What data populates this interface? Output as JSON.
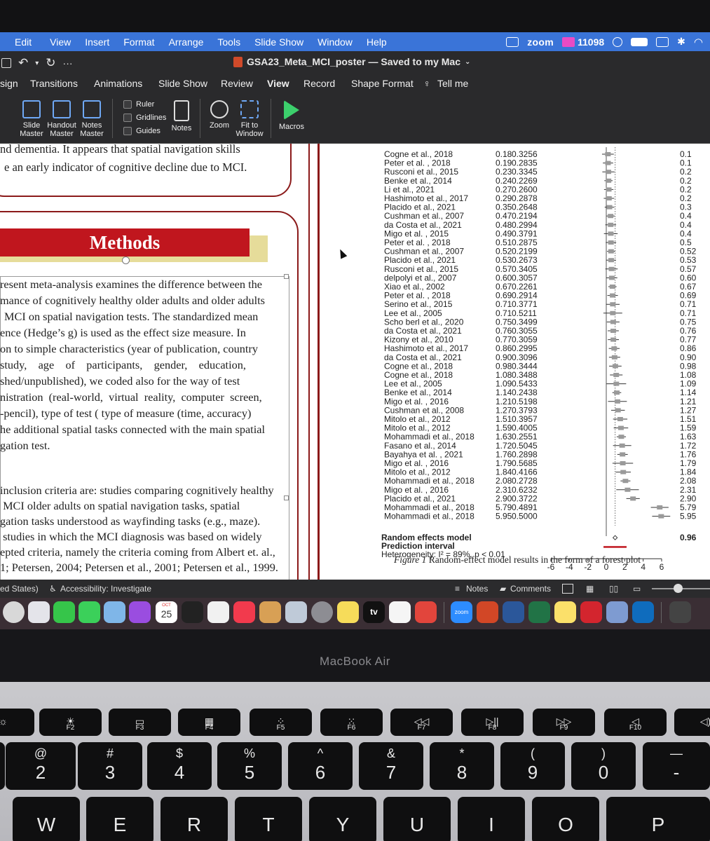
{
  "menubar": {
    "items": [
      "Edit",
      "View",
      "Insert",
      "Format",
      "Arrange",
      "Tools",
      "Slide Show",
      "Window",
      "Help"
    ],
    "zoom": "zoom",
    "mail_count": "11098"
  },
  "titlebar": {
    "document_title": "GSA23_Meta_MCI_poster — Saved to my Mac",
    "qa_more": "···"
  },
  "ribbon": {
    "tabs": [
      "sign",
      "Transitions",
      "Animations",
      "Slide Show",
      "Review",
      "View",
      "Record",
      "Shape Format",
      "Tell me"
    ],
    "active_tab": "View",
    "buttons": {
      "slide_master": [
        "Slide",
        "Master"
      ],
      "handout_master": [
        "Handout",
        "Master"
      ],
      "notes_master": [
        "Notes",
        "Master"
      ],
      "notes": "Notes",
      "zoom": "Zoom",
      "fit_to_window": [
        "Fit to",
        "Window"
      ],
      "macros": "Macros"
    },
    "checkboxes": [
      "Ruler",
      "Gridlines",
      "Guides"
    ]
  },
  "slide": {
    "intro_lines": [
      "nd dementia. It appears that spatial navigation skills",
      "e an early indicator of cognitive decline due to MCI."
    ],
    "methods_heading": "Methods",
    "methods_para1": [
      "resent meta-analysis examines the difference between the",
      "mance of cognitively healthy older adults and older adults",
      "MCI on spatial navigation tests. The standardized mean",
      "ence (Hedge’s g) is used as the effect size measure. In",
      "on to simple characteristics (year of publication, country",
      "study,    age    of    participants,    gender,    education,",
      "shed/unpublished), we coded also for the way of test",
      "nistration  (real-world,  virtual  reality,  computer  screen,",
      "-pencil), type of test ( type of measure (time, accuracy)",
      "he additional spatial tasks connected with the main spatial",
      "gation test."
    ],
    "methods_para2": [
      "inclusion criteria are: studies comparing cognitively healthy",
      " MCI older adults on spatial navigation tasks, spatial",
      "gation tasks understood as wayfinding tasks (e.g., maze).",
      " studies in which the MCI diagnosis was based on widely",
      "epted criteria, namely the criteria coming from Albert et. al.,",
      "1; Petersen, 2004; Petersen et al., 2001; Petersen et al., 1999."
    ],
    "figure_caption_label": "Figure 1",
    "figure_caption_text": " Random-effect model results in the form of a forest plot"
  },
  "chart_data": {
    "type": "scatter",
    "title": "",
    "xlabel": "",
    "xlim": [
      -6,
      6
    ],
    "xticks": [
      "-6",
      "-4",
      "-2",
      "0",
      "2",
      "4",
      "6"
    ],
    "rows": [
      {
        "study": "Cogne et al., 2018",
        "g": "0.18",
        "se": "0.3256",
        "right": "0.1"
      },
      {
        "study": "Peter et al. , 2018",
        "g": "0.19",
        "se": "0.2835",
        "right": "0.1"
      },
      {
        "study": "Rusconi et al., 2015",
        "g": "0.23",
        "se": "0.3345",
        "right": "0.2"
      },
      {
        "study": "Benke et al., 2014",
        "g": "0.24",
        "se": "0.2269",
        "right": "0.2"
      },
      {
        "study": "Li et al., 2021",
        "g": "0.27",
        "se": "0.2600",
        "right": "0.2"
      },
      {
        "study": "Hashimoto et al., 2017",
        "g": "0.29",
        "se": "0.2878",
        "right": "0.2"
      },
      {
        "study": "Placido et al., 2021",
        "g": "0.35",
        "se": "0.2648",
        "right": "0.3"
      },
      {
        "study": "Cushman et al., 2007",
        "g": "0.47",
        "se": "0.2194",
        "right": "0.4"
      },
      {
        "study": "da Costa et al., 2021",
        "g": "0.48",
        "se": "0.2994",
        "right": "0.4"
      },
      {
        "study": "Migo et al. , 2015",
        "g": "0.49",
        "se": "0.3791",
        "right": "0.4"
      },
      {
        "study": "Peter et al. , 2018",
        "g": "0.51",
        "se": "0.2875",
        "right": "0.5"
      },
      {
        "study": "Cushman et al., 2007",
        "g": "0.52",
        "se": "0.2199",
        "right": "0.52"
      },
      {
        "study": "Placido et al., 2021",
        "g": "0.53",
        "se": "0.2673",
        "right": "0.53"
      },
      {
        "study": "Rusconi et al., 2015",
        "g": "0.57",
        "se": "0.3405",
        "right": "0.57"
      },
      {
        "study": "delpolyi et al., 2007",
        "g": "0.60",
        "se": "0.3057",
        "right": "0.60"
      },
      {
        "study": "Xiao et al., 2002",
        "g": "0.67",
        "se": "0.2261",
        "right": "0.67"
      },
      {
        "study": "Peter et al. , 2018",
        "g": "0.69",
        "se": "0.2914",
        "right": "0.69"
      },
      {
        "study": "Serino et al., 2015",
        "g": "0.71",
        "se": "0.3771",
        "right": "0.71"
      },
      {
        "study": "Lee et al., 2005",
        "g": "0.71",
        "se": "0.5211",
        "right": "0.71"
      },
      {
        "study": "Scho berl et al., 2020",
        "g": "0.75",
        "se": "0.3499",
        "right": "0.75"
      },
      {
        "study": "da Costa et al., 2021",
        "g": "0.76",
        "se": "0.3055",
        "right": "0.76"
      },
      {
        "study": "Kizony et al., 2010",
        "g": "0.77",
        "se": "0.3059",
        "right": "0.77"
      },
      {
        "study": "Hashimoto et al., 2017",
        "g": "0.86",
        "se": "0.2995",
        "right": "0.86"
      },
      {
        "study": "da Costa et al., 2021",
        "g": "0.90",
        "se": "0.3096",
        "right": "0.90"
      },
      {
        "study": "Cogne et al., 2018",
        "g": "0.98",
        "se": "0.3444",
        "right": "0.98"
      },
      {
        "study": "Cogne et al., 2018",
        "g": "1.08",
        "se": "0.3488",
        "right": "1.08"
      },
      {
        "study": "Lee et al., 2005",
        "g": "1.09",
        "se": "0.5433",
        "right": "1.09"
      },
      {
        "study": "Benke et al., 2014",
        "g": "1.14",
        "se": "0.2438",
        "right": "1.14"
      },
      {
        "study": "Migo et al. , 2016",
        "g": "1.21",
        "se": "0.5198",
        "right": "1.21"
      },
      {
        "study": "Cushman et al., 2008",
        "g": "1.27",
        "se": "0.3793",
        "right": "1.27"
      },
      {
        "study": "Mitolo et al., 2012",
        "g": "1.51",
        "se": "0.3957",
        "right": "1.51"
      },
      {
        "study": "Mitolo et al., 2012",
        "g": "1.59",
        "se": "0.4005",
        "right": "1.59"
      },
      {
        "study": "Mohammadi et al., 2018",
        "g": "1.63",
        "se": "0.2551",
        "right": "1.63"
      },
      {
        "study": "Fasano et al., 2014",
        "g": "1.72",
        "se": "0.5045",
        "right": "1.72"
      },
      {
        "study": "Bayahya et al. , 2021",
        "g": "1.76",
        "se": "0.2898",
        "right": "1.76"
      },
      {
        "study": "Migo et al. , 2016",
        "g": "1.79",
        "se": "0.5685",
        "right": "1.79"
      },
      {
        "study": "Mitolo et al., 2012",
        "g": "1.84",
        "se": "0.4166",
        "right": "1.84"
      },
      {
        "study": "Mohammadi et al., 2018",
        "g": "2.08",
        "se": "0.2728",
        "right": "2.08"
      },
      {
        "study": "Migo et al. , 2016",
        "g": "2.31",
        "se": "0.6232",
        "right": "2.31"
      },
      {
        "study": "Placido et al., 2021",
        "g": "2.90",
        "se": "0.3722",
        "right": "2.90"
      },
      {
        "study": "Mohammadi et al., 2018",
        "g": "5.79",
        "se": "0.4891",
        "right": "5.79"
      },
      {
        "study": "Mohammadi et al., 2018",
        "g": "5.95",
        "se": "0.5000",
        "right": "5.95"
      }
    ],
    "summary": {
      "random_effects_label": "Random effects model",
      "prediction_label": "Prediction interval",
      "heterogeneity": "Heterogeneity: I² = 89%, p < 0.01",
      "estimate_text": "0.96",
      "estimate": 0.96,
      "ci": [
        0.73,
        1.19
      ],
      "prediction_interval": [
        -0.3,
        2.2
      ]
    },
    "colors": {
      "ci_line": "#333333",
      "square": "#9a9a9a",
      "prediction": "#c0161e"
    }
  },
  "statusbar": {
    "language": "ed States)",
    "accessibility": "Accessibility: Investigate",
    "notes": "Notes",
    "comments": "Comments"
  },
  "dock": {
    "calendar_month": "OCT",
    "calendar_day": "25",
    "tv_label": "tv",
    "zoom_label": "zoom"
  },
  "laptop": {
    "brand": "MacBook Air",
    "fkeys": [
      "F2",
      "F3",
      "F4",
      "F5",
      "F6",
      "F7",
      "F8",
      "F9",
      "F10"
    ],
    "number_keys": [
      {
        "top": "@",
        "bot": "2"
      },
      {
        "top": "#",
        "bot": "3"
      },
      {
        "top": "$",
        "bot": "4"
      },
      {
        "top": "%",
        "bot": "5"
      },
      {
        "top": "^",
        "bot": "6"
      },
      {
        "top": "&",
        "bot": "7"
      },
      {
        "top": "*",
        "bot": "8"
      },
      {
        "top": "(",
        "bot": "9"
      },
      {
        "top": ")",
        "bot": "0"
      },
      {
        "top": "—",
        "bot": "-"
      }
    ],
    "letter_keys": [
      "W",
      "E",
      "R",
      "T",
      "Y",
      "U",
      "I",
      "O",
      "P"
    ]
  }
}
